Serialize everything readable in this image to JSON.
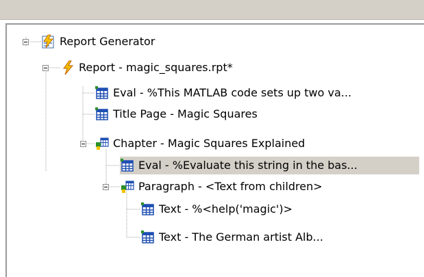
{
  "tree": {
    "nodes": [
      {
        "label": "Report Generator",
        "icon": "report-generator-icon"
      },
      {
        "label": "Report - magic_squares.rpt*",
        "icon": "lightning-icon"
      },
      {
        "label": "Eval - %This MATLAB code sets up two va...",
        "icon": "table-icon"
      },
      {
        "label": "Title Page - Magic Squares",
        "icon": "table-icon"
      },
      {
        "label": "Chapter - Magic Squares Explained",
        "icon": "component-group-icon"
      },
      {
        "label": "Eval - %Evaluate this string in the bas...",
        "icon": "table-icon",
        "selected": true
      },
      {
        "label": "Paragraph - <Text from children>",
        "icon": "component-group-icon"
      },
      {
        "label": "Text - %<help('magic')>",
        "icon": "table-icon"
      },
      {
        "label": "Text - The German artist Alb...",
        "icon": "table-icon"
      }
    ]
  },
  "colors": {
    "selection": "#d4d0c8",
    "tree_lines": "#a0a0a0",
    "lightning": "#f2c200",
    "table_blue": "#1f4fb3"
  }
}
